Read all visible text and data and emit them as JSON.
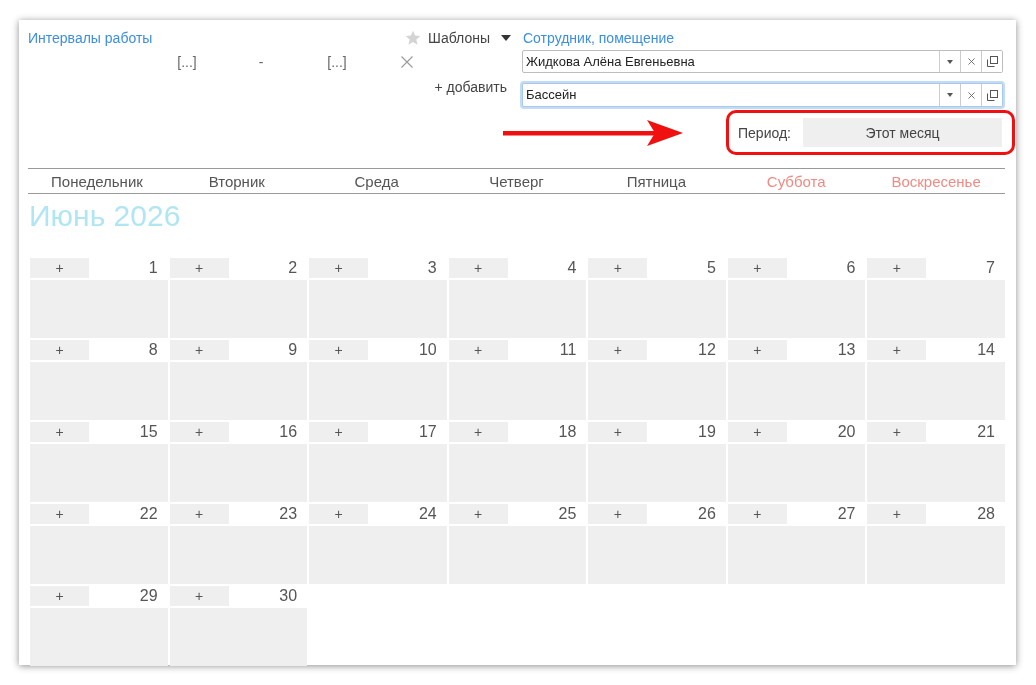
{
  "work_intervals": {
    "title": "Интервалы работы",
    "templates_button": "Шаблоны",
    "interval": {
      "start": "[...]",
      "separator": "-",
      "end": "[...]"
    },
    "add_link": "+ добавить"
  },
  "filter": {
    "title": "Сотрудник, помещение",
    "fields": [
      {
        "value": "Жидкова Алёна Евгеньевна",
        "focused": false
      },
      {
        "value": "Бассейн",
        "focused": true
      }
    ]
  },
  "period": {
    "label": "Период:",
    "value": "Этот месяц"
  },
  "calendar": {
    "weekdays": [
      {
        "label": "Понедельник",
        "weekend": false
      },
      {
        "label": "Вторник",
        "weekend": false
      },
      {
        "label": "Среда",
        "weekend": false
      },
      {
        "label": "Четверг",
        "weekend": false
      },
      {
        "label": "Пятница",
        "weekend": false
      },
      {
        "label": "Суббота",
        "weekend": true
      },
      {
        "label": "Воскресенье",
        "weekend": true
      }
    ],
    "month_title": "Июнь 2026",
    "days": [
      {
        "day": "1",
        "add_label": "+"
      },
      {
        "day": "2",
        "add_label": "+"
      },
      {
        "day": "3",
        "add_label": "+"
      },
      {
        "day": "4",
        "add_label": "+"
      },
      {
        "day": "5",
        "add_label": "+"
      },
      {
        "day": "6",
        "add_label": "+"
      },
      {
        "day": "7",
        "add_label": "+"
      },
      {
        "day": "8",
        "add_label": "+"
      },
      {
        "day": "9",
        "add_label": "+"
      },
      {
        "day": "10",
        "add_label": "+"
      },
      {
        "day": "11",
        "add_label": "+"
      },
      {
        "day": "12",
        "add_label": "+"
      },
      {
        "day": "13",
        "add_label": "+"
      },
      {
        "day": "14",
        "add_label": "+"
      },
      {
        "day": "15",
        "add_label": "+"
      },
      {
        "day": "16",
        "add_label": "+"
      },
      {
        "day": "17",
        "add_label": "+"
      },
      {
        "day": "18",
        "add_label": "+"
      },
      {
        "day": "19",
        "add_label": "+"
      },
      {
        "day": "20",
        "add_label": "+"
      },
      {
        "day": "21",
        "add_label": "+"
      },
      {
        "day": "22",
        "add_label": "+"
      },
      {
        "day": "23",
        "add_label": "+"
      },
      {
        "day": "24",
        "add_label": "+"
      },
      {
        "day": "25",
        "add_label": "+"
      },
      {
        "day": "26",
        "add_label": "+"
      },
      {
        "day": "27",
        "add_label": "+"
      },
      {
        "day": "28",
        "add_label": "+"
      },
      {
        "day": "29",
        "add_label": "+"
      },
      {
        "day": "30",
        "add_label": "+"
      }
    ]
  }
}
